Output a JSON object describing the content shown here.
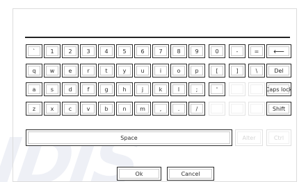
{
  "keyboard": {
    "rows": [
      [
        "`",
        "1",
        "2",
        "3",
        "4",
        "5",
        "6",
        "7",
        "8",
        "9",
        "0",
        "-",
        "="
      ],
      [
        "q",
        "w",
        "e",
        "r",
        "t",
        "y",
        "u",
        "i",
        "o",
        "p",
        "[",
        "]",
        "\\"
      ],
      [
        "a",
        "s",
        "d",
        "f",
        "g",
        "h",
        "j",
        "k",
        "l",
        ";",
        "'"
      ],
      [
        "z",
        "x",
        "c",
        "v",
        "b",
        "n",
        "m",
        ",",
        ".",
        "/"
      ]
    ],
    "backspace_icon": "left-arrow-icon",
    "backspace_glyph": "⟵",
    "del_label": "Del",
    "caps_lock_label": "Caps lock",
    "shift_label": "Shift",
    "space_label": "Space",
    "alter_label": "Alter",
    "ctrl_label": "Ctrl",
    "ok_label": "Ok",
    "cancel_label": "Cancel"
  },
  "input": {
    "value": ""
  },
  "colors": {
    "key_border": "#2a2a2a",
    "disabled_text": "#d6d6d6",
    "watermark": "#eef0f6"
  }
}
